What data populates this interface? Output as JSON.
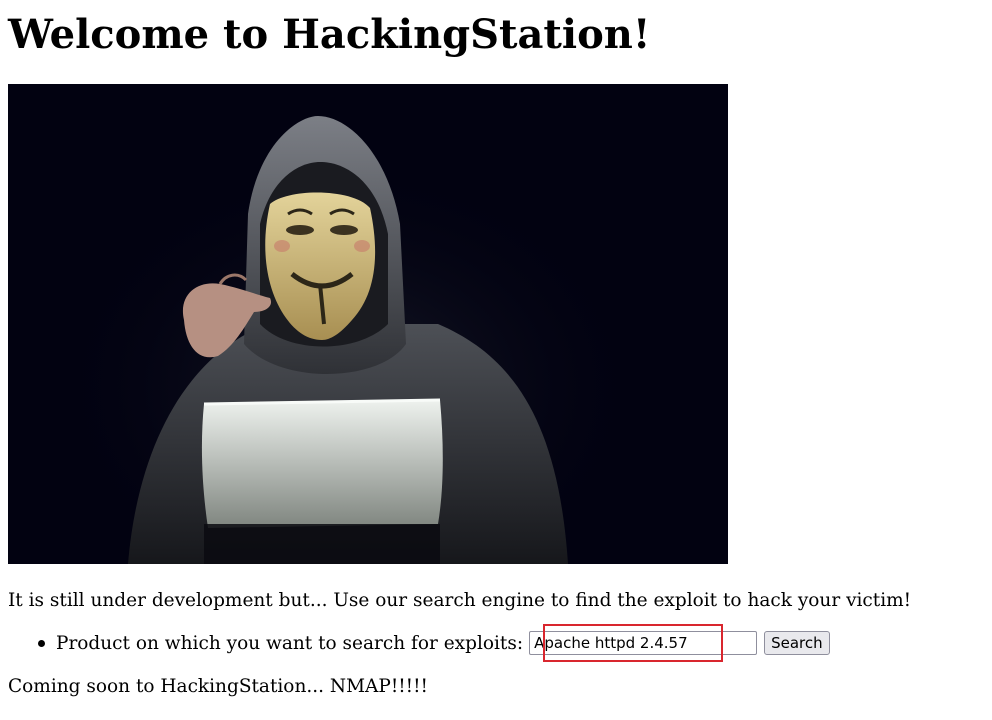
{
  "page": {
    "heading": "Welcome to HackingStation!",
    "intro_text": "It is still under development but... Use our search engine to find the exploit to hack your victim!",
    "outro_text": "Coming soon to HackingStation... NMAP!!!!!"
  },
  "hero_image": {
    "alt": "Hooded hacker in a Guy Fawkes mask pointing at the viewer over a glowing laptop"
  },
  "search": {
    "label": "Product on which you want to search for exploits:",
    "input_value": "Apache httpd 2.4.57",
    "button_label": "Search"
  },
  "colors": {
    "highlight_border": "#d9262e",
    "image_background": "#020211"
  }
}
